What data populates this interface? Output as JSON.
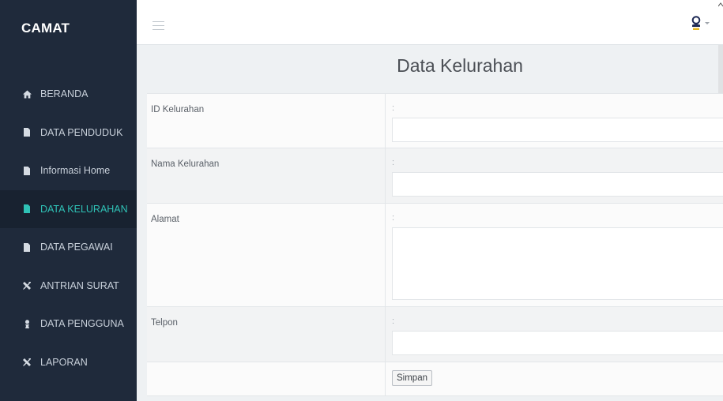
{
  "app": {
    "brand": "CAMAT"
  },
  "sidebar": {
    "items": [
      {
        "label": "BERANDA",
        "icon": "home-icon",
        "active": false
      },
      {
        "label": "DATA PENDUDUK",
        "icon": "file-icon",
        "active": false
      },
      {
        "label": "Informasi Home",
        "icon": "file-icon",
        "active": false
      },
      {
        "label": "DATA KELURAHAN",
        "icon": "file-icon",
        "active": true
      },
      {
        "label": "DATA PEGAWAI",
        "icon": "file-icon",
        "active": false
      },
      {
        "label": "ANTRIAN SURAT",
        "icon": "tools-icon",
        "active": false
      },
      {
        "label": "DATA PENGGUNA",
        "icon": "user-icon",
        "active": false
      },
      {
        "label": "LAPORAN",
        "icon": "tools-icon",
        "active": false
      }
    ],
    "colors": {
      "background": "#1f2a3b",
      "active_background": "#182230",
      "active_text": "#2fc2b6"
    }
  },
  "topbar": {
    "menu_icon": "hamburger-icon",
    "user_icon": "user-avatar-icon"
  },
  "page": {
    "title": "Data Kelurahan"
  },
  "form": {
    "colon": ":",
    "fields": [
      {
        "label": "ID Kelurahan",
        "value": ""
      },
      {
        "label": "Nama Kelurahan",
        "value": ""
      },
      {
        "label": "Alamat",
        "value": ""
      },
      {
        "label": "Telpon",
        "value": ""
      }
    ],
    "submit_label": "Simpan"
  }
}
